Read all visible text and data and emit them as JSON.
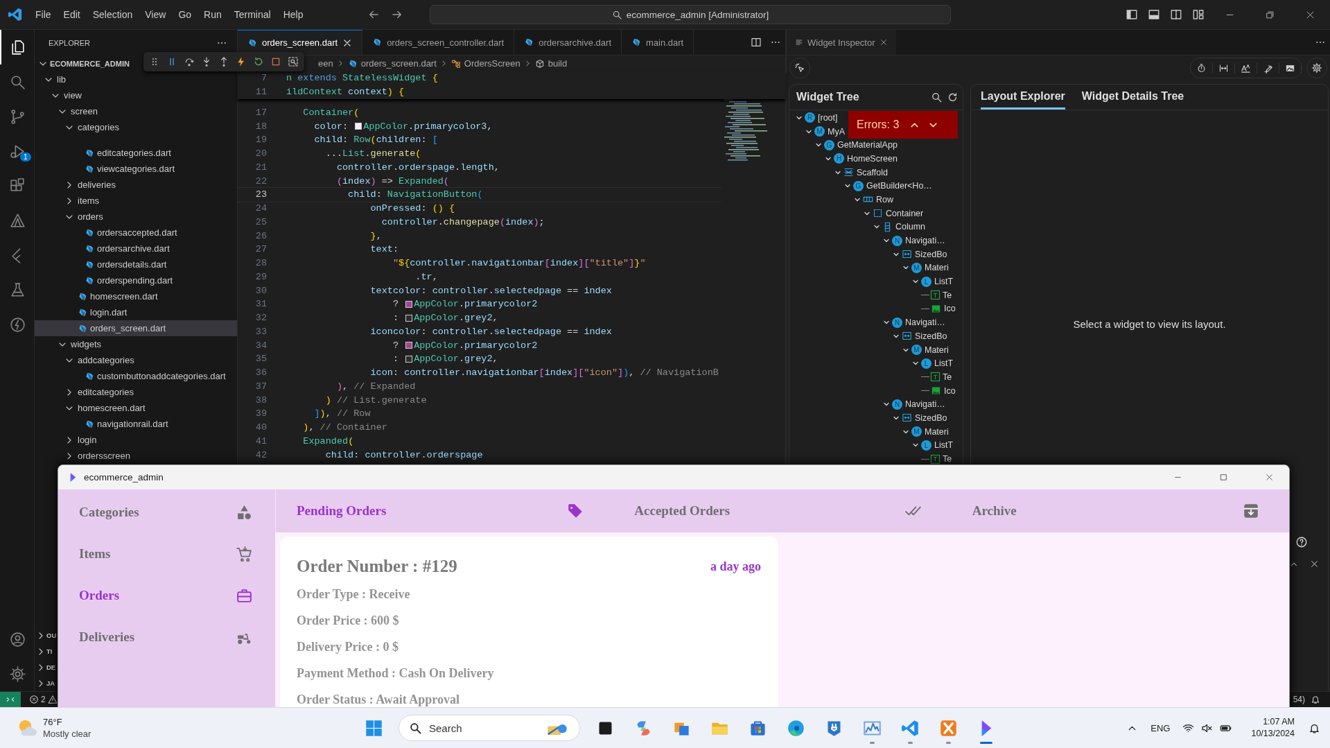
{
  "titlebar": {
    "menu": [
      "File",
      "Edit",
      "Selection",
      "View",
      "Go",
      "Run",
      "Terminal",
      "Help"
    ],
    "command_center": "ecommerce_admin [Administrator]"
  },
  "activity_bar": {
    "items": [
      {
        "kind": "files",
        "selected": true
      },
      {
        "kind": "search",
        "selected": false
      },
      {
        "kind": "branch",
        "selected": false
      },
      {
        "kind": "debug",
        "selected": false,
        "badge": "1"
      },
      {
        "kind": "extensions",
        "selected": false
      },
      {
        "kind": "triangle",
        "selected": false
      },
      {
        "kind": "flutter",
        "selected": false
      },
      {
        "kind": "flask",
        "selected": false
      },
      {
        "kind": "bolt-circle",
        "selected": false
      }
    ],
    "bottom": [
      {
        "kind": "account"
      },
      {
        "kind": "gear"
      }
    ]
  },
  "explorer": {
    "title": "EXPLORER",
    "root": "ECOMMERCE_ADMIN",
    "tree": [
      {
        "label": "lib",
        "kind": "folder",
        "expanded": true,
        "selected": false,
        "children": [
          {
            "label": "view",
            "kind": "folder",
            "expanded": true,
            "selected": false,
            "children": [
              {
                "label": "screen",
                "kind": "folder",
                "expanded": true,
                "selected": false,
                "children": [
                  {
                    "label": "categories",
                    "kind": "folder",
                    "expanded": true,
                    "selected": false,
                    "children": [
                      {
                        "label": "editcategories.dart",
                        "kind": "file",
                        "selected": false
                      },
                      {
                        "label": "viewcategories.dart",
                        "kind": "file",
                        "selected": false
                      }
                    ]
                  },
                  {
                    "label": "deliveries",
                    "kind": "folder",
                    "expanded": false,
                    "selected": false
                  },
                  {
                    "label": "items",
                    "kind": "folder",
                    "expanded": false,
                    "selected": false
                  },
                  {
                    "label": "orders",
                    "kind": "folder",
                    "expanded": true,
                    "selected": false,
                    "children": [
                      {
                        "label": "ordersaccepted.dart",
                        "kind": "file",
                        "selected": false
                      },
                      {
                        "label": "ordersarchive.dart",
                        "kind": "file",
                        "selected": false
                      },
                      {
                        "label": "ordersdetails.dart",
                        "kind": "file",
                        "selected": false
                      },
                      {
                        "label": "orderspending.dart",
                        "kind": "file",
                        "selected": false
                      }
                    ]
                  },
                  {
                    "label": "homescreen.dart",
                    "kind": "file",
                    "selected": false
                  },
                  {
                    "label": "login.dart",
                    "kind": "file",
                    "selected": false
                  },
                  {
                    "label": "orders_screen.dart",
                    "kind": "file",
                    "selected": true
                  }
                ]
              },
              {
                "label": "widgets",
                "kind": "folder",
                "expanded": true,
                "selected": false,
                "children": [
                  {
                    "label": "addcategories",
                    "kind": "folder",
                    "expanded": true,
                    "selected": false,
                    "children": [
                      {
                        "label": "custombuttonaddcategories.dart",
                        "kind": "file",
                        "selected": false
                      }
                    ]
                  },
                  {
                    "label": "editcategories",
                    "kind": "folder",
                    "expanded": false,
                    "selected": false
                  },
                  {
                    "label": "homescreen.dart",
                    "kind": "folder",
                    "expanded": true,
                    "selected": false,
                    "children": [
                      {
                        "label": "navigationrail.dart",
                        "kind": "file",
                        "selected": false
                      }
                    ]
                  },
                  {
                    "label": "login",
                    "kind": "folder",
                    "expanded": false,
                    "selected": false
                  },
                  {
                    "label": "ordersscreen",
                    "kind": "folder",
                    "expanded": false,
                    "selected": false
                  }
                ]
              }
            ]
          }
        ]
      }
    ],
    "sections": [
      "OU",
      "TI",
      "DE",
      "JA"
    ]
  },
  "debug_toolbar": [
    {
      "kind": "grip"
    },
    {
      "kind": "pause"
    },
    {
      "kind": "step-over"
    },
    {
      "kind": "step-into"
    },
    {
      "kind": "step-out"
    },
    {
      "kind": "hot-reload"
    },
    {
      "kind": "restart"
    },
    {
      "kind": "stop"
    },
    {
      "kind": "inspect"
    }
  ],
  "editor": {
    "tabs": [
      {
        "label": "orders_screen.dart",
        "selected": true
      },
      {
        "label": "orders_screen_controller.dart",
        "selected": false
      },
      {
        "label": "ordersarchive.dart",
        "selected": false
      },
      {
        "label": "main.dart",
        "selected": false
      }
    ],
    "breadcrumb": [
      {
        "label": "een",
        "kind": "plain"
      },
      {
        "label": "orders_screen.dart",
        "kind": "dart"
      },
      {
        "label": "OrdersScreen",
        "kind": "class"
      },
      {
        "label": "build",
        "kind": "method"
      }
    ],
    "sticky_lines": [
      {
        "num": "7",
        "tokens": [
          {
            "kind": "c",
            "text": "n"
          },
          {
            "kind": "k",
            "text": " extends"
          },
          {
            "kind": "c",
            "text": " StatelessWidget"
          },
          {
            "kind": "b1",
            "text": " {"
          }
        ]
      },
      {
        "num": "11",
        "tokens": [
          {
            "kind": "c",
            "text": "ildContext"
          },
          {
            "kind": "v",
            "text": " context"
          },
          {
            "kind": "b1",
            "text": ")"
          },
          {
            "kind": "b1",
            "text": " {"
          }
        ]
      }
    ],
    "lines": [
      {
        "num": "17",
        "current": false,
        "tokens": [
          {
            "kind": "c",
            "text": "   Container"
          },
          {
            "kind": "b1",
            "text": "("
          }
        ]
      },
      {
        "num": "18",
        "current": false,
        "tokens": [
          {
            "kind": "v",
            "text": "     color"
          },
          {
            "kind": "p",
            "text": ": "
          },
          {
            "kind": "swatch",
            "color": "#f3edf7"
          },
          {
            "kind": "c",
            "text": "AppColor"
          },
          {
            "kind": "p",
            "text": "."
          },
          {
            "kind": "v",
            "text": "primarycolor3"
          },
          {
            "kind": "p",
            "text": ","
          }
        ]
      },
      {
        "num": "19",
        "current": false,
        "tokens": [
          {
            "kind": "v",
            "text": "     child"
          },
          {
            "kind": "p",
            "text": ": "
          },
          {
            "kind": "c",
            "text": "Row"
          },
          {
            "kind": "b1",
            "text": "("
          },
          {
            "kind": "v",
            "text": "children"
          },
          {
            "kind": "p",
            "text": ": "
          },
          {
            "kind": "b3",
            "text": "["
          }
        ]
      },
      {
        "num": "20",
        "current": false,
        "tokens": [
          {
            "kind": "p",
            "text": "       ..."
          },
          {
            "kind": "c",
            "text": "List"
          },
          {
            "kind": "p",
            "text": "."
          },
          {
            "kind": "f",
            "text": "generate"
          },
          {
            "kind": "b1",
            "text": "("
          }
        ]
      },
      {
        "num": "21",
        "current": false,
        "tokens": [
          {
            "kind": "v",
            "text": "         controller"
          },
          {
            "kind": "p",
            "text": "."
          },
          {
            "kind": "v",
            "text": "orderspage"
          },
          {
            "kind": "p",
            "text": "."
          },
          {
            "kind": "v",
            "text": "length"
          },
          {
            "kind": "p",
            "text": ","
          }
        ]
      },
      {
        "num": "22",
        "current": false,
        "tokens": [
          {
            "kind": "b2",
            "text": "         ("
          },
          {
            "kind": "v",
            "text": "index"
          },
          {
            "kind": "b2",
            "text": ")"
          },
          {
            "kind": "p",
            "text": " => "
          },
          {
            "kind": "c",
            "text": "Expanded"
          },
          {
            "kind": "b2",
            "text": "("
          }
        ]
      },
      {
        "num": "23",
        "current": true,
        "tokens": [
          {
            "kind": "v",
            "text": "           child"
          },
          {
            "kind": "p",
            "text": ": "
          },
          {
            "kind": "c",
            "text": "NavigationButton"
          },
          {
            "kind": "b3",
            "text": "("
          }
        ]
      },
      {
        "num": "24",
        "current": false,
        "tokens": [
          {
            "kind": "v",
            "text": "               onPressed"
          },
          {
            "kind": "p",
            "text": ": "
          },
          {
            "kind": "b1",
            "text": "()"
          },
          {
            "kind": "b1",
            "text": " {"
          }
        ]
      },
      {
        "num": "25",
        "current": false,
        "tokens": [
          {
            "kind": "v",
            "text": "                 controller"
          },
          {
            "kind": "p",
            "text": "."
          },
          {
            "kind": "f",
            "text": "changepage"
          },
          {
            "kind": "b2",
            "text": "("
          },
          {
            "kind": "v",
            "text": "index"
          },
          {
            "kind": "b2",
            "text": ")"
          },
          {
            "kind": "p",
            "text": ";"
          }
        ]
      },
      {
        "num": "26",
        "current": false,
        "tokens": [
          {
            "kind": "b1",
            "text": "               }"
          },
          {
            "kind": "p",
            "text": ","
          }
        ]
      },
      {
        "num": "27",
        "current": false,
        "tokens": [
          {
            "kind": "v",
            "text": "               text"
          },
          {
            "kind": "p",
            "text": ":"
          }
        ]
      },
      {
        "num": "28",
        "current": false,
        "tokens": [
          {
            "kind": "s",
            "text": "                   \""
          },
          {
            "kind": "b1",
            "text": "${"
          },
          {
            "kind": "v",
            "text": "controller"
          },
          {
            "kind": "p",
            "text": "."
          },
          {
            "kind": "v",
            "text": "navigationbar"
          },
          {
            "kind": "b2",
            "text": "["
          },
          {
            "kind": "v",
            "text": "index"
          },
          {
            "kind": "b2",
            "text": "]["
          },
          {
            "kind": "s",
            "text": "\"title\""
          },
          {
            "kind": "b2",
            "text": "]"
          },
          {
            "kind": "b1",
            "text": "}"
          },
          {
            "kind": "s",
            "text": "\""
          }
        ]
      },
      {
        "num": "29",
        "current": false,
        "tokens": [
          {
            "kind": "p",
            "text": "                       ."
          },
          {
            "kind": "v",
            "text": "tr"
          },
          {
            "kind": "p",
            "text": ","
          }
        ]
      },
      {
        "num": "30",
        "current": false,
        "tokens": [
          {
            "kind": "v",
            "text": "               textcolor"
          },
          {
            "kind": "p",
            "text": ": "
          },
          {
            "kind": "v",
            "text": "controller"
          },
          {
            "kind": "p",
            "text": "."
          },
          {
            "kind": "v",
            "text": "selectedpage"
          },
          {
            "kind": "p",
            "text": " == "
          },
          {
            "kind": "v",
            "text": "index"
          }
        ]
      },
      {
        "num": "31",
        "current": false,
        "tokens": [
          {
            "kind": "p",
            "text": "                   ? "
          },
          {
            "kind": "swatch",
            "color": "#a0468e"
          },
          {
            "kind": "c",
            "text": "AppColor"
          },
          {
            "kind": "p",
            "text": "."
          },
          {
            "kind": "v",
            "text": "primarycolor2"
          }
        ]
      },
      {
        "num": "32",
        "current": false,
        "tokens": [
          {
            "kind": "p",
            "text": "                   : "
          },
          {
            "kind": "swatch",
            "color": "#2d2d2d"
          },
          {
            "kind": "c",
            "text": "AppColor"
          },
          {
            "kind": "p",
            "text": "."
          },
          {
            "kind": "v",
            "text": "grey2"
          },
          {
            "kind": "p",
            "text": ","
          }
        ]
      },
      {
        "num": "33",
        "current": false,
        "tokens": [
          {
            "kind": "v",
            "text": "               iconcolor"
          },
          {
            "kind": "p",
            "text": ": "
          },
          {
            "kind": "v",
            "text": "controller"
          },
          {
            "kind": "p",
            "text": "."
          },
          {
            "kind": "v",
            "text": "selectedpage"
          },
          {
            "kind": "p",
            "text": " == "
          },
          {
            "kind": "v",
            "text": "index"
          }
        ]
      },
      {
        "num": "34",
        "current": false,
        "tokens": [
          {
            "kind": "p",
            "text": "                   ? "
          },
          {
            "kind": "swatch",
            "color": "#a0468e"
          },
          {
            "kind": "c",
            "text": "AppColor"
          },
          {
            "kind": "p",
            "text": "."
          },
          {
            "kind": "v",
            "text": "primarycolor2"
          }
        ]
      },
      {
        "num": "35",
        "current": false,
        "tokens": [
          {
            "kind": "p",
            "text": "                   : "
          },
          {
            "kind": "swatch",
            "color": "#2d2d2d"
          },
          {
            "kind": "c",
            "text": "AppColor"
          },
          {
            "kind": "p",
            "text": "."
          },
          {
            "kind": "v",
            "text": "grey2"
          },
          {
            "kind": "p",
            "text": ","
          }
        ]
      },
      {
        "num": "36",
        "current": false,
        "tokens": [
          {
            "kind": "v",
            "text": "               icon"
          },
          {
            "kind": "p",
            "text": ": "
          },
          {
            "kind": "v",
            "text": "controller"
          },
          {
            "kind": "p",
            "text": "."
          },
          {
            "kind": "v",
            "text": "navigationbar"
          },
          {
            "kind": "b2",
            "text": "["
          },
          {
            "kind": "v",
            "text": "index"
          },
          {
            "kind": "b2",
            "text": "]["
          },
          {
            "kind": "s",
            "text": "\"icon\""
          },
          {
            "kind": "b2",
            "text": "]"
          },
          {
            "kind": "b3",
            "text": ")"
          },
          {
            "kind": "p",
            "text": ","
          },
          {
            "kind": "m",
            "text": " // NavigationB"
          }
        ]
      },
      {
        "num": "37",
        "current": false,
        "tokens": [
          {
            "kind": "b2",
            "text": "         )"
          },
          {
            "kind": "p",
            "text": ","
          },
          {
            "kind": "m",
            "text": " // Expanded"
          }
        ]
      },
      {
        "num": "38",
        "current": false,
        "tokens": [
          {
            "kind": "b1",
            "text": "       )"
          },
          {
            "kind": "m",
            "text": " // List.generate"
          }
        ]
      },
      {
        "num": "39",
        "current": false,
        "tokens": [
          {
            "kind": "b3",
            "text": "     ]"
          },
          {
            "kind": "b1",
            "text": ")"
          },
          {
            "kind": "p",
            "text": ","
          },
          {
            "kind": "m",
            "text": " // Row"
          }
        ]
      },
      {
        "num": "40",
        "current": false,
        "tokens": [
          {
            "kind": "b1",
            "text": "   )"
          },
          {
            "kind": "p",
            "text": ","
          },
          {
            "kind": "m",
            "text": " // Container"
          }
        ]
      },
      {
        "num": "41",
        "current": false,
        "tokens": [
          {
            "kind": "c",
            "text": "   Expanded"
          },
          {
            "kind": "b1",
            "text": "("
          }
        ]
      },
      {
        "num": "42",
        "current": false,
        "tokens": [
          {
            "kind": "v",
            "text": "       child"
          },
          {
            "kind": "p",
            "text": ": "
          },
          {
            "kind": "v",
            "text": "controller"
          },
          {
            "kind": "p",
            "text": "."
          },
          {
            "kind": "v",
            "text": "orderspage"
          }
        ]
      }
    ]
  },
  "inspector": {
    "tab": "Widget Inspector",
    "tree_title": "Widget Tree",
    "errors": "Errors: 3",
    "tree": [
      {
        "label": "[root]",
        "kind": "badge",
        "badge": "R",
        "expanded": true,
        "children": [
          {
            "label": "MyA",
            "kind": "badge",
            "badge": "M",
            "expanded": true,
            "children": [
              {
                "label": "GetMaterialApp",
                "kind": "badge",
                "badge": "G",
                "expanded": true,
                "children": [
                  {
                    "label": "HomeScreen",
                    "kind": "badge",
                    "badge": "H",
                    "expanded": true,
                    "children": [
                      {
                        "label": "Scaffold",
                        "kind": "scaffold",
                        "expanded": true,
                        "children": [
                          {
                            "label": "GetBuilder<Ho…",
                            "kind": "badge",
                            "badge": "G",
                            "expanded": true,
                            "children": [
                              {
                                "label": "Row",
                                "kind": "row",
                                "expanded": true,
                                "children": [
                                  {
                                    "label": "Container",
                                    "kind": "container",
                                    "expanded": true,
                                    "children": [
                                      {
                                        "label": "Column",
                                        "kind": "column",
                                        "expanded": true,
                                        "children": [
                                          {
                                            "label": "Navigati…",
                                            "kind": "badge",
                                            "badge": "N",
                                            "expanded": true,
                                            "children": [
                                              {
                                                "label": "SizedBo",
                                                "kind": "sizedbox",
                                                "expanded": true,
                                                "children": [
                                                  {
                                                    "label": "Materi",
                                                    "kind": "badge",
                                                    "badge": "M",
                                                    "expanded": true,
                                                    "children": [
                                                      {
                                                        "label": "ListT",
                                                        "kind": "badge",
                                                        "badge": "L",
                                                        "expanded": true,
                                                        "children": [
                                                          {
                                                            "label": "Te",
                                                            "kind": "text",
                                                            "badge": "T"
                                                          },
                                                          {
                                                            "label": "Ico",
                                                            "kind": "image"
                                                          }
                                                        ]
                                                      }
                                                    ]
                                                  }
                                                ]
                                              }
                                            ]
                                          },
                                          {
                                            "label": "Navigati…",
                                            "kind": "badge",
                                            "badge": "N",
                                            "expanded": true,
                                            "children": [
                                              {
                                                "label": "SizedBo",
                                                "kind": "sizedbox",
                                                "expanded": true,
                                                "children": [
                                                  {
                                                    "label": "Materi",
                                                    "kind": "badge",
                                                    "badge": "M",
                                                    "expanded": true,
                                                    "children": [
                                                      {
                                                        "label": "ListT",
                                                        "kind": "badge",
                                                        "badge": "L",
                                                        "expanded": true,
                                                        "children": [
                                                          {
                                                            "label": "Te",
                                                            "kind": "text",
                                                            "badge": "T"
                                                          },
                                                          {
                                                            "label": "Ico",
                                                            "kind": "image"
                                                          }
                                                        ]
                                                      }
                                                    ]
                                                  }
                                                ]
                                              }
                                            ]
                                          },
                                          {
                                            "label": "Navigati…",
                                            "kind": "badge",
                                            "badge": "N",
                                            "expanded": true,
                                            "children": [
                                              {
                                                "label": "SizedBo",
                                                "kind": "sizedbox",
                                                "expanded": true,
                                                "children": [
                                                  {
                                                    "label": "Materi",
                                                    "kind": "badge",
                                                    "badge": "M",
                                                    "expanded": true,
                                                    "children": [
                                                      {
                                                        "label": "ListT",
                                                        "kind": "badge",
                                                        "badge": "L",
                                                        "expanded": true,
                                                        "children": [
                                                          {
                                                            "label": "Te",
                                                            "kind": "text",
                                                            "badge": "T"
                                                          }
                                                        ]
                                                      }
                                                    ]
                                                  }
                                                ]
                                              }
                                            ]
                                          }
                                        ]
                                      }
                                    ]
                                  }
                                ]
                              }
                            ]
                          }
                        ]
                      }
                    ]
                  }
                ]
              }
            ]
          }
        ]
      }
    ],
    "detail_tabs": [
      {
        "label": "Layout Explorer",
        "selected": true
      },
      {
        "label": "Widget Details Tree",
        "selected": false
      }
    ],
    "message": "Select a widget to view its layout."
  },
  "status_bar": {
    "errors": "2",
    "right_text": "54)"
  },
  "app_window": {
    "title": "ecommerce_admin",
    "sidebar": [
      {
        "label": "Categories",
        "kind": "shapes",
        "selected": false
      },
      {
        "label": "Items",
        "kind": "cart",
        "selected": false
      },
      {
        "label": "Orders",
        "kind": "briefcase",
        "selected": true
      },
      {
        "label": "Deliveries",
        "kind": "scooter",
        "selected": false
      }
    ],
    "tabs": [
      {
        "label": "Pending Orders",
        "kind": "tag",
        "selected": true
      },
      {
        "label": "Accepted Orders",
        "kind": "double-check",
        "selected": false
      },
      {
        "label": "Archive",
        "kind": "archive",
        "selected": false
      }
    ],
    "order": {
      "number": "Order Number : #129",
      "time": "a day ago",
      "fields": [
        "Order Type : Receive",
        "Order Price : 600 $",
        "Delivery Price : 0 $",
        "Payment Method : Cash On Delivery",
        "Order Status : Await Approval"
      ]
    }
  },
  "taskbar": {
    "weather": {
      "temp": "76°F",
      "condition": "Mostly clear"
    },
    "search": {
      "placeholder": "Search"
    },
    "apps": [
      {
        "kind": "square",
        "running": false,
        "selected": false
      },
      {
        "kind": "swirl",
        "running": false,
        "selected": false
      },
      {
        "kind": "squares",
        "running": false,
        "selected": false
      },
      {
        "kind": "folder",
        "running": false,
        "selected": false
      },
      {
        "kind": "store",
        "running": false,
        "selected": false
      },
      {
        "kind": "browser",
        "running": false,
        "selected": false
      },
      {
        "kind": "plug",
        "running": false,
        "selected": false
      },
      {
        "kind": "chart",
        "running": true,
        "selected": false
      },
      {
        "kind": "code",
        "running": true,
        "selected": false
      },
      {
        "kind": "crossed",
        "running": true,
        "selected": false
      },
      {
        "kind": "app",
        "running": true,
        "selected": true
      }
    ],
    "tray": {
      "language": "ENG",
      "time": "1:07 AM",
      "date": "10/13/2024"
    }
  }
}
